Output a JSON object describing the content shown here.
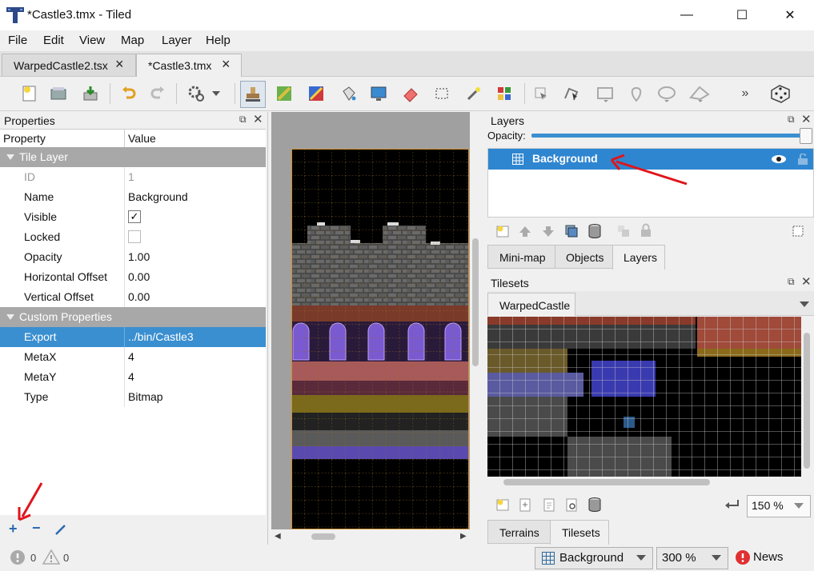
{
  "window": {
    "title": "*Castle3.tmx - Tiled",
    "minimize": "—",
    "maximize": "☐",
    "close": "✕"
  },
  "menu": [
    "File",
    "Edit",
    "View",
    "Map",
    "Layer",
    "Help"
  ],
  "tabs": [
    {
      "label": "WarpedCastle2.tsx"
    },
    {
      "label": "*Castle3.tmx"
    }
  ],
  "properties": {
    "title": "Properties",
    "col_property": "Property",
    "col_value": "Value",
    "group_tile_layer": "Tile Layer",
    "id_label": "ID",
    "id_value": "1",
    "name_label": "Name",
    "name_value": "Background",
    "visible_label": "Visible",
    "visible_value": "✓",
    "locked_label": "Locked",
    "opacity_label": "Opacity",
    "opacity_value": "1.00",
    "hoffset_label": "Horizontal Offset",
    "hoffset_value": "0.00",
    "voffset_label": "Vertical Offset",
    "voffset_value": "0.00",
    "group_custom": "Custom Properties",
    "export_label": "Export",
    "export_value": "../bin/Castle3",
    "metax_label": "MetaX",
    "metax_value": "4",
    "metay_label": "MetaY",
    "metay_value": "4",
    "type_label": "Type",
    "type_value": "Bitmap"
  },
  "layers": {
    "title": "Layers",
    "opacity_label": "Opacity:",
    "opacity_level": 1.0,
    "layer_name": "Background",
    "tabs": [
      "Mini-map",
      "Objects",
      "Layers"
    ]
  },
  "tilesets": {
    "title": "Tilesets",
    "tab": "WarpedCastle",
    "zoom": "150 %",
    "bottom_tabs": [
      "Terrains",
      "Tilesets"
    ]
  },
  "status": {
    "errors": "0",
    "warnings": "0",
    "layer": "Background",
    "zoom": "300 %",
    "news": "News"
  },
  "colors": {
    "accent": "#3a8fd0",
    "selection": "#2f86d0",
    "group": "#a8a8a8"
  }
}
